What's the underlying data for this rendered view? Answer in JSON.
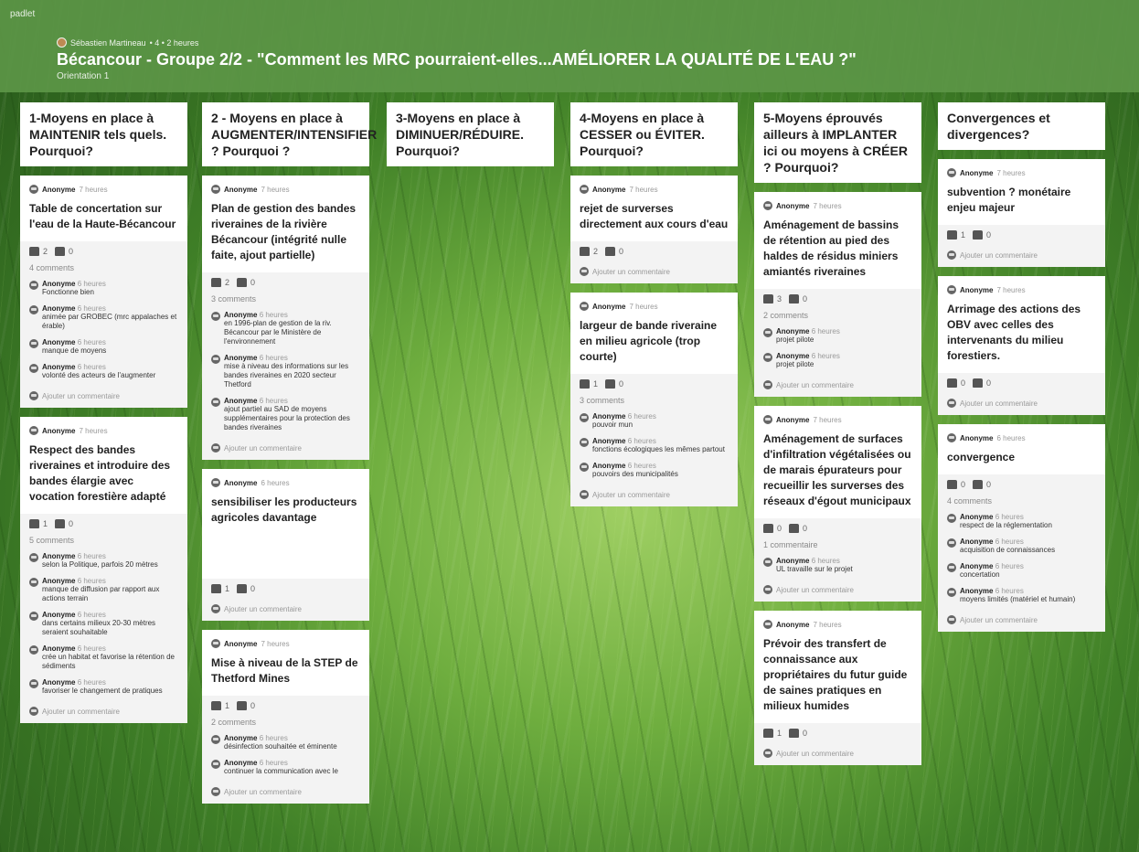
{
  "app": {
    "brand": "padlet",
    "author": "Sébastien Martineau",
    "meta_sep": "• 4 • 2 heures",
    "title": "Bécancour - Groupe 2/2 - \"Comment les MRC pourraient-elles...AMÉLIORER LA QUALITÉ DE L'EAU ?\"",
    "subtitle": "Orientation 1"
  },
  "labels": {
    "add_comment": "Ajouter un commentaire",
    "add_comment_alt": "Ajouter un commentaire"
  },
  "columns": [
    {
      "title": "1-Moyens en place à MAINTENIR tels quels. Pourquoi?",
      "cards": [
        {
          "author": "Anonyme",
          "time": "7 heures",
          "text": "Table de concertation sur l'eau de la Haute-Bécancour",
          "up": "2",
          "down": "0",
          "count": "4 comments",
          "comments": [
            {
              "author": "Anonyme",
              "time": "6 heures",
              "text": "Fonctionne bien"
            },
            {
              "author": "Anonyme",
              "time": "6 heures",
              "text": "animée par GROBEC (mrc appalaches et érable)"
            },
            {
              "author": "Anonyme",
              "time": "6 heures",
              "text": "manque de moyens"
            },
            {
              "author": "Anonyme",
              "time": "6 heures",
              "text": "volonté des acteurs de l'augmenter"
            }
          ]
        },
        {
          "author": "Anonyme",
          "time": "7 heures",
          "text": "Respect des bandes riveraines et introduire des bandes élargie avec vocation forestière adapté",
          "up": "1",
          "down": "0",
          "count": "5 comments",
          "comments": [
            {
              "author": "Anonyme",
              "time": "6 heures",
              "text": "selon la Politique, parfois 20 mètres"
            },
            {
              "author": "Anonyme",
              "time": "6 heures",
              "text": "manque de diffusion par rapport aux actions terrain"
            },
            {
              "author": "Anonyme",
              "time": "6 heures",
              "text": "dans certains milieux 20-30 mètres seraient souhaitable"
            },
            {
              "author": "Anonyme",
              "time": "6 heures",
              "text": "crée un habitat et favorise la rétention de sédiments"
            },
            {
              "author": "Anonyme",
              "time": "6 heures",
              "text": "favoriser le changement de pratiques"
            }
          ]
        }
      ]
    },
    {
      "title": "2 - Moyens en place à AUGMENTER/INTENSIFIER ? Pourquoi ?",
      "cards": [
        {
          "author": "Anonyme",
          "time": "7 heures",
          "text": "Plan de gestion des bandes riveraines de la rivière Bécancour  (intégrité nulle faite, ajout partielle)",
          "up": "2",
          "down": "0",
          "count": "3 comments",
          "comments": [
            {
              "author": "Anonyme",
              "time": "6 heures",
              "text": "en 1996-plan de gestion de la riv. Bécancour par le Ministère de l'environnement"
            },
            {
              "author": "Anonyme",
              "time": "6 heures",
              "text": "mise à niveau des informations sur les bandes riveraines en 2020 secteur Thetford"
            },
            {
              "author": "Anonyme",
              "time": "6 heures",
              "text": "ajout partiel au SAD de moyens supplémentaires pour la protection des bandes riveraines"
            }
          ]
        },
        {
          "author": "Anonyme",
          "time": "6 heures",
          "text": "sensibiliser les producteurs agricoles davantage",
          "up": "1",
          "down": "0",
          "count": "",
          "comments": [],
          "spacer": true
        },
        {
          "author": "Anonyme",
          "time": "7 heures",
          "text": "Mise à niveau de la STEP de Thetford Mines",
          "up": "1",
          "down": "0",
          "count": "2 comments",
          "comments": [
            {
              "author": "Anonyme",
              "time": "6 heures",
              "text": "désinfection souhaitée et éminente"
            },
            {
              "author": "Anonyme",
              "time": "6 heures",
              "text": "continuer la communication avec le"
            }
          ]
        }
      ]
    },
    {
      "title": "3-Moyens en place à DIMINUER/RÉDUIRE. Pourquoi?",
      "cards": []
    },
    {
      "title": "4-Moyens en place à CESSER ou ÉVITER. Pourquoi?",
      "cards": [
        {
          "author": "Anonyme",
          "time": "7 heures",
          "text": "rejet de surverses directement aux cours d'eau",
          "up": "2",
          "down": "0",
          "count": "",
          "comments": []
        },
        {
          "author": "Anonyme",
          "time": "7 heures",
          "text": "largeur de bande riveraine en milieu agricole (trop courte)",
          "up": "1",
          "down": "0",
          "count": "3 comments",
          "comments": [
            {
              "author": "Anonyme",
              "time": "6 heures",
              "text": "pouvoir mun"
            },
            {
              "author": "Anonyme",
              "time": "6 heures",
              "text": "fonctions écologiques les mêmes partout"
            },
            {
              "author": "Anonyme",
              "time": "6 heures",
              "text": "pouvoirs des municipalités"
            }
          ]
        }
      ]
    },
    {
      "title": "5-Moyens éprouvés ailleurs à IMPLANTER ici ou moyens à CRÉER ? Pourquoi?",
      "cards": [
        {
          "author": "Anonyme",
          "time": "7 heures",
          "text": "Aménagement de bassins de rétention au pied des haldes de résidus miniers amiantés riveraines",
          "up": "3",
          "down": "0",
          "count": "2 comments",
          "comments": [
            {
              "author": "Anonyme",
              "time": "6 heures",
              "text": "projet pilote"
            },
            {
              "author": "Anonyme",
              "time": "6 heures",
              "text": "projet pilote"
            }
          ]
        },
        {
          "author": "Anonyme",
          "time": "7 heures",
          "text": "Aménagement de surfaces d'infiltration végétalisées ou de marais épurateurs pour recueillir les surverses des réseaux d'égout municipaux",
          "up": "0",
          "down": "0",
          "count": "1 commentaire",
          "comments": [
            {
              "author": "Anonyme",
              "time": "6 heures",
              "text": "UL travaille sur le projet"
            }
          ]
        },
        {
          "author": "Anonyme",
          "time": "7 heures",
          "text": "Prévoir des transfert de connaissance aux propriétaires du futur guide de saines pratiques en milieux humides",
          "up": "1",
          "down": "0",
          "count": "",
          "comments": []
        }
      ]
    },
    {
      "title": "Convergences et divergences?",
      "cards": [
        {
          "author": "Anonyme",
          "time": "7 heures",
          "text": "subvention ? monétaire enjeu majeur",
          "up": "1",
          "down": "0",
          "count": "",
          "comments": []
        },
        {
          "author": "Anonyme",
          "time": "7 heures",
          "text": "Arrimage  des actions des OBV avec celles des intervenants du milieu forestiers.",
          "up": "0",
          "down": "0",
          "count": "",
          "comments": []
        },
        {
          "author": "Anonyme",
          "time": "6 heures",
          "text": "convergence",
          "up": "0",
          "down": "0",
          "count": "4 comments",
          "comments": [
            {
              "author": "Anonyme",
              "time": "6 heures",
              "text": "respect de la réglementation"
            },
            {
              "author": "Anonyme",
              "time": "6 heures",
              "text": "acquisition de connaissances"
            },
            {
              "author": "Anonyme",
              "time": "6 heures",
              "text": "concertation"
            },
            {
              "author": "Anonyme",
              "time": "6 heures",
              "text": "moyens limités (matériel et humain)"
            }
          ]
        }
      ]
    }
  ]
}
